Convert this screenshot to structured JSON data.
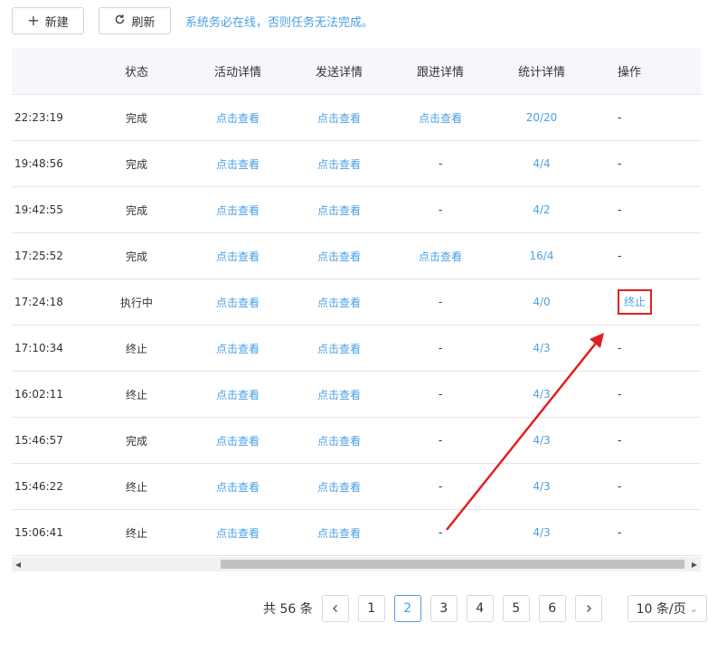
{
  "toolbar": {
    "new_label": "新建",
    "new_icon": "plus-icon",
    "refresh_label": "刷新",
    "refresh_icon": "refresh-icon",
    "notice": "系统务必在线，否则任务无法完成。"
  },
  "table": {
    "headers": [
      "",
      "状态",
      "活动详情",
      "发送详情",
      "跟进详情",
      "统计详情",
      "操作"
    ],
    "rows": [
      {
        "time": "22:23:19",
        "status": "完成",
        "activity": "点击查看",
        "send": "点击查看",
        "followup": "点击查看",
        "stats": "20/20",
        "action": "-"
      },
      {
        "time": "19:48:56",
        "status": "完成",
        "activity": "点击查看",
        "send": "点击查看",
        "followup": "-",
        "stats": "4/4",
        "action": "-"
      },
      {
        "time": "19:42:55",
        "status": "完成",
        "activity": "点击查看",
        "send": "点击查看",
        "followup": "-",
        "stats": "4/2",
        "action": "-"
      },
      {
        "time": "17:25:52",
        "status": "完成",
        "activity": "点击查看",
        "send": "点击查看",
        "followup": "点击查看",
        "stats": "16/4",
        "action": "-"
      },
      {
        "time": "17:24:18",
        "status": "执行中",
        "activity": "点击查看",
        "send": "点击查看",
        "followup": "-",
        "stats": "4/0",
        "action": "终止"
      },
      {
        "time": "17:10:34",
        "status": "终止",
        "activity": "点击查看",
        "send": "点击查看",
        "followup": "-",
        "stats": "4/3",
        "action": "-"
      },
      {
        "time": "16:02:11",
        "status": "终止",
        "activity": "点击查看",
        "send": "点击查看",
        "followup": "-",
        "stats": "4/3",
        "action": "-"
      },
      {
        "time": "15:46:57",
        "status": "完成",
        "activity": "点击查看",
        "send": "点击查看",
        "followup": "-",
        "stats": "4/3",
        "action": "-"
      },
      {
        "time": "15:46:22",
        "status": "终止",
        "activity": "点击查看",
        "send": "点击查看",
        "followup": "-",
        "stats": "4/3",
        "action": "-"
      },
      {
        "time": "15:06:41",
        "status": "终止",
        "activity": "点击查看",
        "send": "点击查看",
        "followup": "-",
        "stats": "4/3",
        "action": "-"
      }
    ]
  },
  "scrollbar": {
    "left_icon": "triangle-left-icon",
    "right_icon": "triangle-right-icon"
  },
  "pagination": {
    "total": "共 56 条",
    "prev_icon": "chevron-left-icon",
    "next_icon": "chevron-right-icon",
    "pages": [
      "1",
      "2",
      "3",
      "4",
      "5",
      "6"
    ],
    "active_page": "2",
    "page_size": "10 条/页",
    "page_size_icon": "chevron-down-icon"
  },
  "annotation": {
    "highlight_color": "#e02020",
    "arrow_icon": "red-arrow"
  },
  "colors": {
    "link": "#4aa0e6",
    "header_bg": "#f5f7fa"
  }
}
